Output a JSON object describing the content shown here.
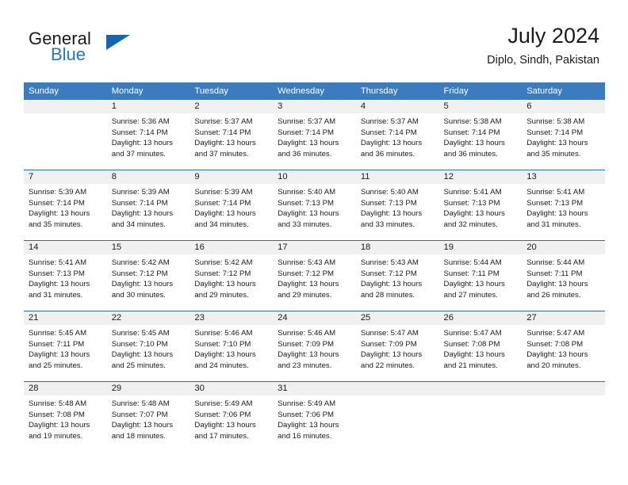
{
  "brand": {
    "name_part1": "General",
    "name_part2": "Blue",
    "triangle_color": "#1566ad",
    "blue_color": "#1f7ac4"
  },
  "header": {
    "title": "July 2024",
    "location": "Diplo, Sindh, Pakistan"
  },
  "theme": {
    "header_bg": "#3a7cbe",
    "separator": "#2b6cac",
    "daynum_band": "#f0f0f0"
  },
  "weekday_headers": [
    "Sunday",
    "Monday",
    "Tuesday",
    "Wednesday",
    "Thursday",
    "Friday",
    "Saturday"
  ],
  "labels": {
    "sunrise_prefix": "Sunrise:",
    "sunset_prefix": "Sunset:",
    "daylight_prefix": "Daylight:"
  },
  "weeks": [
    [
      {
        "day": "",
        "line1": "",
        "line2": "",
        "line3": "",
        "line4": ""
      },
      {
        "day": "1",
        "line1": "Sunrise: 5:36 AM",
        "line2": "Sunset: 7:14 PM",
        "line3": "Daylight: 13 hours",
        "line4": "and 37 minutes."
      },
      {
        "day": "2",
        "line1": "Sunrise: 5:37 AM",
        "line2": "Sunset: 7:14 PM",
        "line3": "Daylight: 13 hours",
        "line4": "and 37 minutes."
      },
      {
        "day": "3",
        "line1": "Sunrise: 5:37 AM",
        "line2": "Sunset: 7:14 PM",
        "line3": "Daylight: 13 hours",
        "line4": "and 36 minutes."
      },
      {
        "day": "4",
        "line1": "Sunrise: 5:37 AM",
        "line2": "Sunset: 7:14 PM",
        "line3": "Daylight: 13 hours",
        "line4": "and 36 minutes."
      },
      {
        "day": "5",
        "line1": "Sunrise: 5:38 AM",
        "line2": "Sunset: 7:14 PM",
        "line3": "Daylight: 13 hours",
        "line4": "and 36 minutes."
      },
      {
        "day": "6",
        "line1": "Sunrise: 5:38 AM",
        "line2": "Sunset: 7:14 PM",
        "line3": "Daylight: 13 hours",
        "line4": "and 35 minutes."
      }
    ],
    [
      {
        "day": "7",
        "line1": "Sunrise: 5:39 AM",
        "line2": "Sunset: 7:14 PM",
        "line3": "Daylight: 13 hours",
        "line4": "and 35 minutes."
      },
      {
        "day": "8",
        "line1": "Sunrise: 5:39 AM",
        "line2": "Sunset: 7:14 PM",
        "line3": "Daylight: 13 hours",
        "line4": "and 34 minutes."
      },
      {
        "day": "9",
        "line1": "Sunrise: 5:39 AM",
        "line2": "Sunset: 7:14 PM",
        "line3": "Daylight: 13 hours",
        "line4": "and 34 minutes."
      },
      {
        "day": "10",
        "line1": "Sunrise: 5:40 AM",
        "line2": "Sunset: 7:13 PM",
        "line3": "Daylight: 13 hours",
        "line4": "and 33 minutes."
      },
      {
        "day": "11",
        "line1": "Sunrise: 5:40 AM",
        "line2": "Sunset: 7:13 PM",
        "line3": "Daylight: 13 hours",
        "line4": "and 33 minutes."
      },
      {
        "day": "12",
        "line1": "Sunrise: 5:41 AM",
        "line2": "Sunset: 7:13 PM",
        "line3": "Daylight: 13 hours",
        "line4": "and 32 minutes."
      },
      {
        "day": "13",
        "line1": "Sunrise: 5:41 AM",
        "line2": "Sunset: 7:13 PM",
        "line3": "Daylight: 13 hours",
        "line4": "and 31 minutes."
      }
    ],
    [
      {
        "day": "14",
        "line1": "Sunrise: 5:41 AM",
        "line2": "Sunset: 7:13 PM",
        "line3": "Daylight: 13 hours",
        "line4": "and 31 minutes."
      },
      {
        "day": "15",
        "line1": "Sunrise: 5:42 AM",
        "line2": "Sunset: 7:12 PM",
        "line3": "Daylight: 13 hours",
        "line4": "and 30 minutes."
      },
      {
        "day": "16",
        "line1": "Sunrise: 5:42 AM",
        "line2": "Sunset: 7:12 PM",
        "line3": "Daylight: 13 hours",
        "line4": "and 29 minutes."
      },
      {
        "day": "17",
        "line1": "Sunrise: 5:43 AM",
        "line2": "Sunset: 7:12 PM",
        "line3": "Daylight: 13 hours",
        "line4": "and 29 minutes."
      },
      {
        "day": "18",
        "line1": "Sunrise: 5:43 AM",
        "line2": "Sunset: 7:12 PM",
        "line3": "Daylight: 13 hours",
        "line4": "and 28 minutes."
      },
      {
        "day": "19",
        "line1": "Sunrise: 5:44 AM",
        "line2": "Sunset: 7:11 PM",
        "line3": "Daylight: 13 hours",
        "line4": "and 27 minutes."
      },
      {
        "day": "20",
        "line1": "Sunrise: 5:44 AM",
        "line2": "Sunset: 7:11 PM",
        "line3": "Daylight: 13 hours",
        "line4": "and 26 minutes."
      }
    ],
    [
      {
        "day": "21",
        "line1": "Sunrise: 5:45 AM",
        "line2": "Sunset: 7:11 PM",
        "line3": "Daylight: 13 hours",
        "line4": "and 25 minutes."
      },
      {
        "day": "22",
        "line1": "Sunrise: 5:45 AM",
        "line2": "Sunset: 7:10 PM",
        "line3": "Daylight: 13 hours",
        "line4": "and 25 minutes."
      },
      {
        "day": "23",
        "line1": "Sunrise: 5:46 AM",
        "line2": "Sunset: 7:10 PM",
        "line3": "Daylight: 13 hours",
        "line4": "and 24 minutes."
      },
      {
        "day": "24",
        "line1": "Sunrise: 5:46 AM",
        "line2": "Sunset: 7:09 PM",
        "line3": "Daylight: 13 hours",
        "line4": "and 23 minutes."
      },
      {
        "day": "25",
        "line1": "Sunrise: 5:47 AM",
        "line2": "Sunset: 7:09 PM",
        "line3": "Daylight: 13 hours",
        "line4": "and 22 minutes."
      },
      {
        "day": "26",
        "line1": "Sunrise: 5:47 AM",
        "line2": "Sunset: 7:08 PM",
        "line3": "Daylight: 13 hours",
        "line4": "and 21 minutes."
      },
      {
        "day": "27",
        "line1": "Sunrise: 5:47 AM",
        "line2": "Sunset: 7:08 PM",
        "line3": "Daylight: 13 hours",
        "line4": "and 20 minutes."
      }
    ],
    [
      {
        "day": "28",
        "line1": "Sunrise: 5:48 AM",
        "line2": "Sunset: 7:08 PM",
        "line3": "Daylight: 13 hours",
        "line4": "and 19 minutes."
      },
      {
        "day": "29",
        "line1": "Sunrise: 5:48 AM",
        "line2": "Sunset: 7:07 PM",
        "line3": "Daylight: 13 hours",
        "line4": "and 18 minutes."
      },
      {
        "day": "30",
        "line1": "Sunrise: 5:49 AM",
        "line2": "Sunset: 7:06 PM",
        "line3": "Daylight: 13 hours",
        "line4": "and 17 minutes."
      },
      {
        "day": "31",
        "line1": "Sunrise: 5:49 AM",
        "line2": "Sunset: 7:06 PM",
        "line3": "Daylight: 13 hours",
        "line4": "and 16 minutes."
      },
      {
        "day": "",
        "line1": "",
        "line2": "",
        "line3": "",
        "line4": ""
      },
      {
        "day": "",
        "line1": "",
        "line2": "",
        "line3": "",
        "line4": ""
      },
      {
        "day": "",
        "line1": "",
        "line2": "",
        "line3": "",
        "line4": ""
      }
    ]
  ]
}
